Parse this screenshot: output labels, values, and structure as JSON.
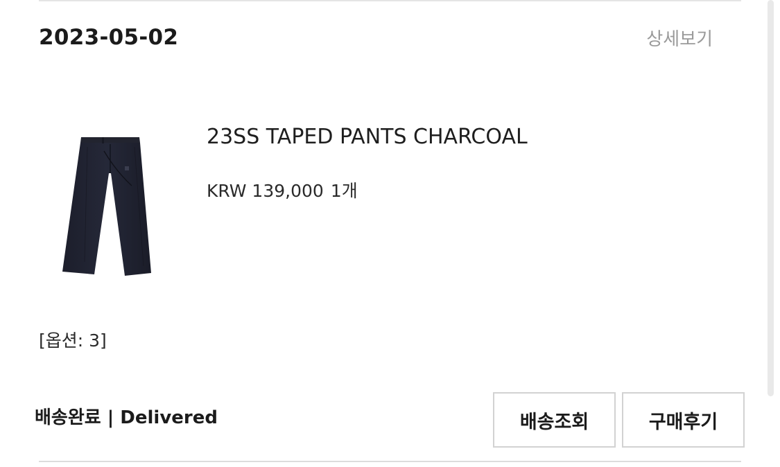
{
  "order": {
    "date": "2023-05-02",
    "detail_link": "상세보기"
  },
  "product": {
    "name": "23SS TAPED PANTS CHARCOAL",
    "price": "KRW 139,000",
    "quantity": "1개",
    "option": "[옵션: 3]",
    "image_icon": "pants-image"
  },
  "status": {
    "text": "배송완료 | Delivered"
  },
  "actions": {
    "track_label": "배송조회",
    "review_label": "구매후기"
  }
}
